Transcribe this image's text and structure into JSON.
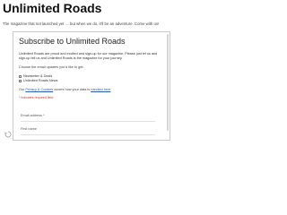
{
  "page": {
    "title": "Unlimited Roads",
    "tagline": "The magazine that not launched yet … but when we do, it'll be an adventure. Come with us!"
  },
  "form": {
    "title": "Subscribe to Unlimited Roads",
    "intro": "Unlimited Roads are proud and excited and sign-up for our magazine. Please just let us and sign-up tell us and Unlimited Roads is the magazine for your journey.",
    "choose_text": "Choose the email updates you'd like to get:",
    "options": [
      {
        "label": "Newsletter & Deals"
      },
      {
        "label": "Unlimited Roads News"
      }
    ],
    "consent_prefix": "Our ",
    "privacy_link": "Privacy & Cookies",
    "consent_middle": " covers how your data is ",
    "terms_link": "handled here",
    "required_note": "* indicates required field",
    "email_label": "Email address *",
    "name_label": "First name"
  },
  "icons": {
    "recaptcha": "recaptcha-icon"
  }
}
